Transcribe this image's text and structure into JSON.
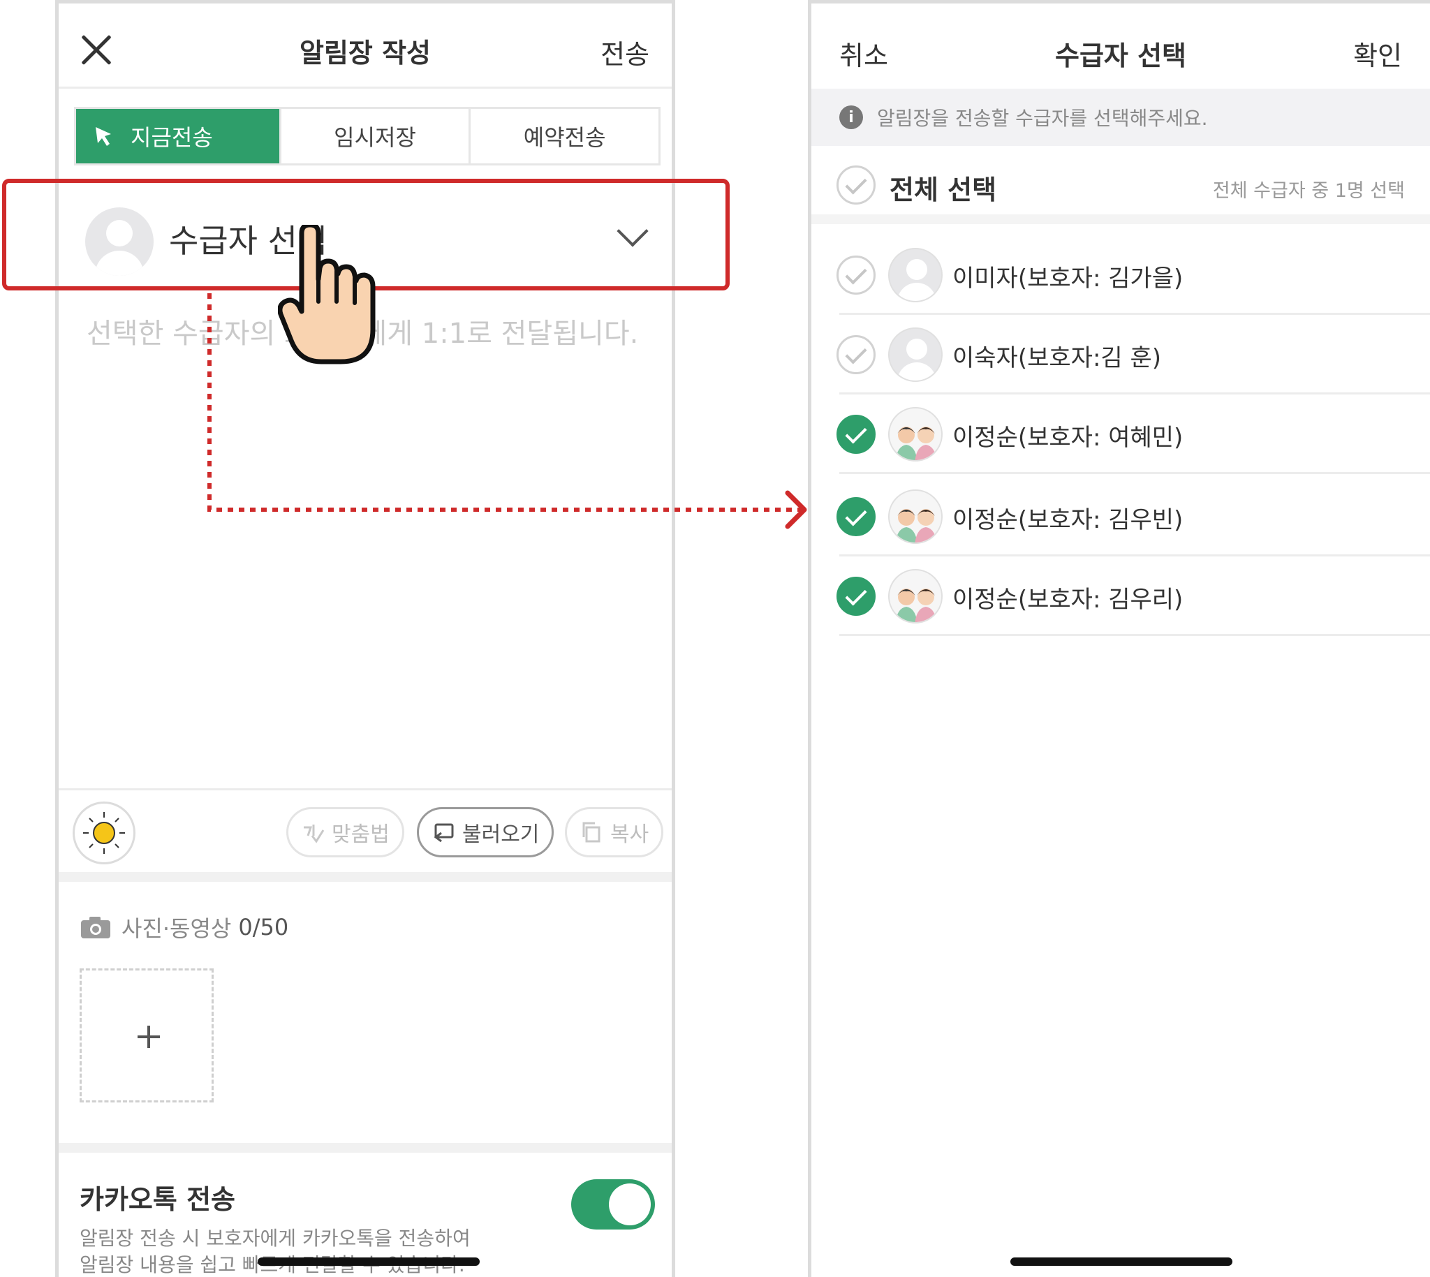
{
  "compose": {
    "title": "알림장 작성",
    "send_button": "전송",
    "tabs": [
      {
        "label": "지금전송",
        "active": true
      },
      {
        "label": "임시저장",
        "active": false
      },
      {
        "label": "예약전송",
        "active": false
      }
    ],
    "recipient_label": "수급자 선택",
    "placeholder": "선택한 수급자의 보호자에게 1:1로 전달됩니다.",
    "tools": {
      "spell": "맞춤법",
      "load": "불러오기",
      "copy": "복사"
    },
    "media_label": "사진·동영상",
    "media_count": "0/50",
    "kakao_title": "카카오톡 전송",
    "kakao_desc_line1": "알림장 전송 시 보호자에게 카카오톡을 전송하여",
    "kakao_desc_line2": "알림장 내용을 쉽고 빠르게 전달할 수 있습니다.",
    "kakao_toggle_on": true
  },
  "selector": {
    "cancel": "취소",
    "title": "수급자 선택",
    "confirm": "확인",
    "info": "알림장을 전송할 수급자를 선택해주세요.",
    "select_all_label": "전체 선택",
    "select_all_count": "전체 수급자 중 1명 선택",
    "recipients": [
      {
        "name": "이미자(보호자: 김가을)",
        "checked": false,
        "avatar": "default-avatar-icon"
      },
      {
        "name": "이숙자(보호자:김 훈)",
        "checked": false,
        "avatar": "default-avatar-icon"
      },
      {
        "name": "이정순(보호자: 여혜민)",
        "checked": true,
        "avatar": "couple-avatar-icon"
      },
      {
        "name": "이정순(보호자: 김우빈)",
        "checked": true,
        "avatar": "couple-avatar-icon"
      },
      {
        "name": "이정순(보호자: 김우리)",
        "checked": true,
        "avatar": "couple-avatar-icon"
      }
    ]
  },
  "colors": {
    "accent_green": "#2e9e6a",
    "highlight_red": "#cf2a2a"
  }
}
